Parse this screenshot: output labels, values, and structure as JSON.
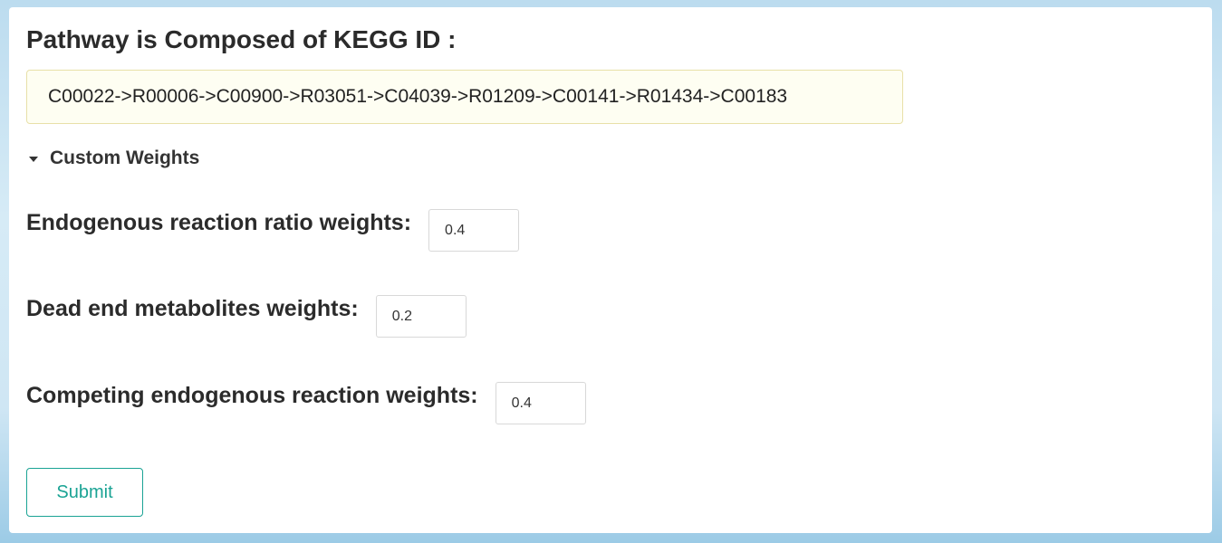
{
  "header": {
    "title": "Pathway is Composed of KEGG ID :"
  },
  "pathway": {
    "ids": "C00022->R00006->C00900->R03051->C04039->R01209->C00141->R01434->C00183"
  },
  "custom_weights": {
    "toggle_label": "Custom Weights",
    "expanded": true
  },
  "fields": {
    "endogenous": {
      "label": "Endogenous reaction ratio weights:",
      "value": "0.4"
    },
    "dead_end": {
      "label": "Dead end metabolites weights:",
      "value": "0.2"
    },
    "competing": {
      "label": "Competing endogenous reaction weights:",
      "value": "0.4"
    }
  },
  "actions": {
    "submit_label": "Submit"
  },
  "colors": {
    "accent": "#1aa394",
    "pathway_bg": "#fefef2",
    "pathway_border": "#e8e0a8"
  }
}
